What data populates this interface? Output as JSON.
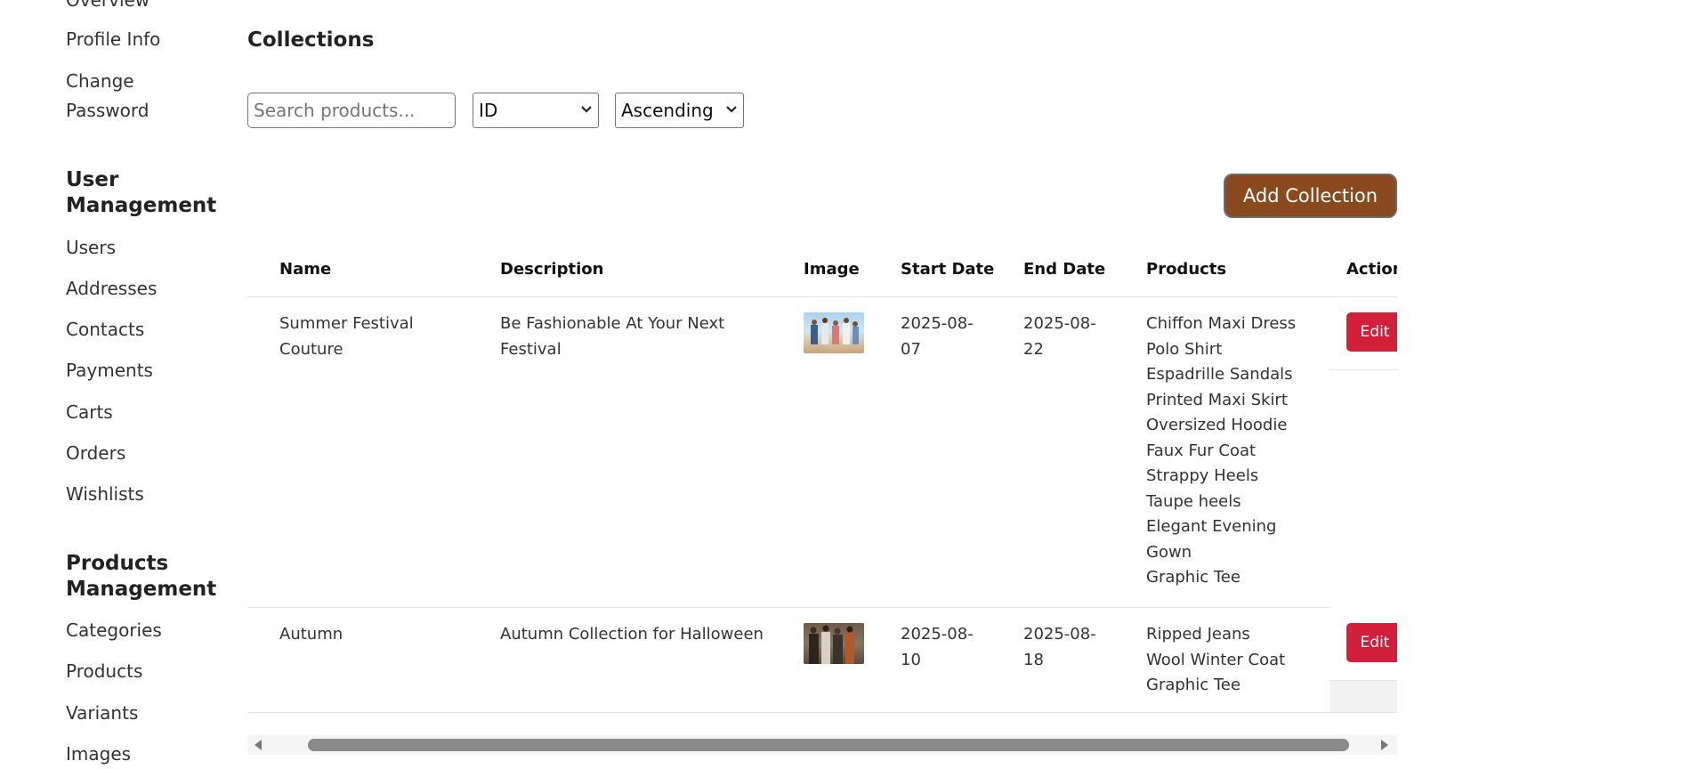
{
  "sidebar": {
    "top_items": [
      "Overview",
      "Profile Info",
      "Change Password"
    ],
    "user_section_title": "User Management",
    "user_items": [
      "Users",
      "Addresses",
      "Contacts",
      "Payments",
      "Carts",
      "Orders",
      "Wishlists"
    ],
    "products_section_title": "Products Management",
    "product_items": [
      "Categories",
      "Products",
      "Variants",
      "Images"
    ]
  },
  "main": {
    "title": "Collections",
    "search_placeholder": "Search products...",
    "sort_field": "ID",
    "sort_order": "Ascending",
    "add_button": "Add Collection"
  },
  "table": {
    "headers": [
      "Name",
      "Description",
      "Image",
      "Start Date",
      "End Date",
      "Products",
      "Action"
    ],
    "rows": [
      {
        "name": "Summer Festival Couture",
        "description": "Be Fashionable At Your Next Festival",
        "image": "summer-festival-photo",
        "start_date": "2025-08-07",
        "end_date": "2025-08-22",
        "products": [
          "Chiffon Maxi Dress",
          "Polo Shirt",
          "Espadrille Sandals",
          "Printed Maxi Skirt",
          "Oversized Hoodie",
          "Faux Fur Coat",
          "Strappy Heels",
          "Taupe heels",
          "Elegant Evening Gown",
          "Graphic Tee"
        ],
        "action": "Edit"
      },
      {
        "name": "Autumn",
        "description": "Autumn Collection for Halloween",
        "image": "autumn-halloween-photo",
        "start_date": "2025-08-10",
        "end_date": "2025-08-18",
        "products": [
          "Ripped Jeans",
          "Wool Winter Coat",
          "Graphic Tee"
        ],
        "action": "Edit"
      }
    ]
  },
  "colors": {
    "add_button": "#8b4a1e",
    "edit_button": "#d21f3c"
  },
  "icons": {
    "select_chevron": "chevron-down-icon",
    "scroll_left": "arrow-left-icon",
    "scroll_right": "arrow-right-icon"
  }
}
